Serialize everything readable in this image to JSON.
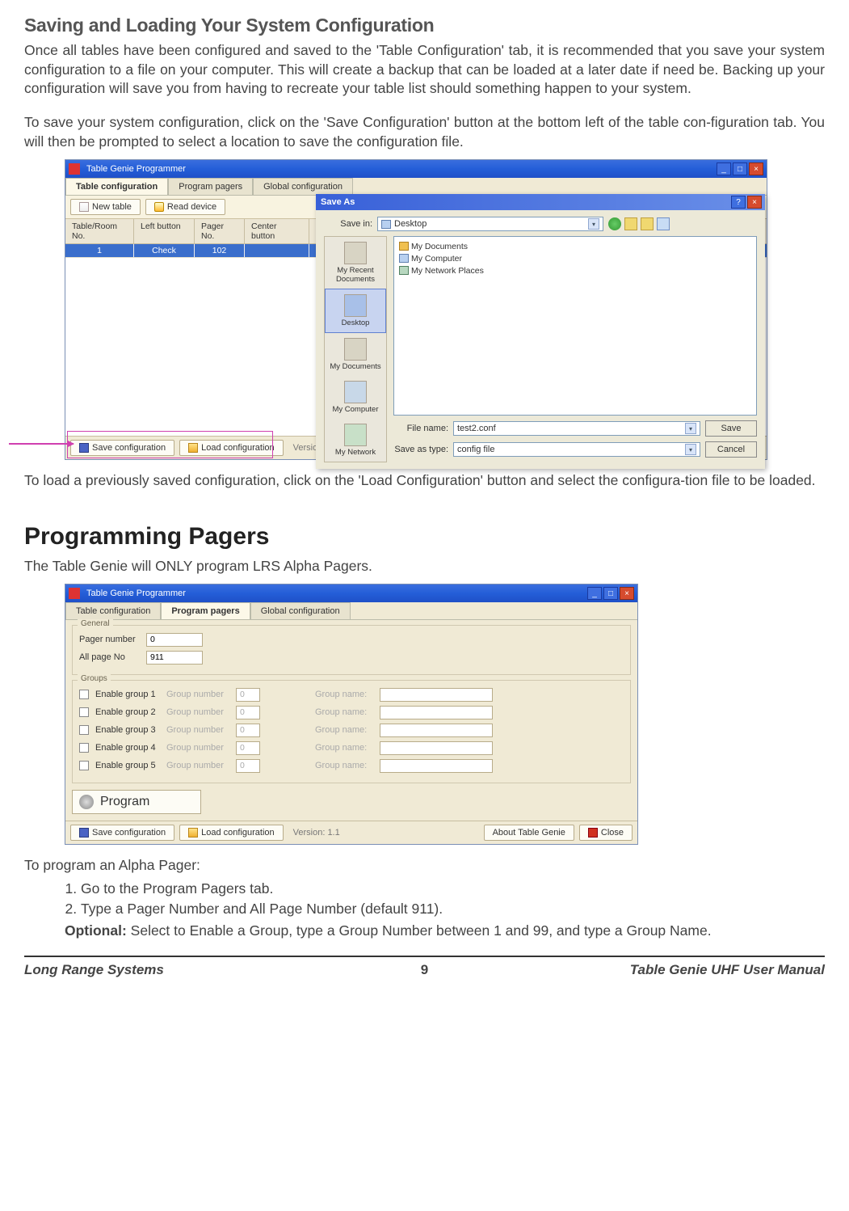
{
  "section1_title": "Saving and Loading Your System Configuration",
  "para1": "Once all tables have been configured and saved to the 'Table Configuration' tab, it is recommended that you save your system configuration to a file on your computer. This will create a backup that can be loaded at a later date if need be. Backing up your configuration will save you from having to recreate your table list should something happen to your system.",
  "para2": "To save your system configuration, click on the 'Save Configuration' button at the bottom left of the table con-figuration tab. You will then be prompted to select a location to save the configuration file.",
  "para3": "To load a previously saved configuration, click on the 'Load Configuration' button and select the configura-tion file to be loaded.",
  "section2_title": "Programming Pagers",
  "para4": "The Table Genie will ONLY program LRS Alpha Pagers.",
  "para5": "To program an Alpha Pager:",
  "step1": "Go to the Program Pagers tab.",
  "step2": "Type a Pager Number and All Page Number (default 911).",
  "optional_lbl": "Optional:",
  "optional_txt": " Select to Enable a Group, type a Group Number between 1 and 99, and type a Group Name.",
  "footer": {
    "left": "Long Range Systems",
    "center": "9",
    "right": "Table Genie UHF User Manual"
  },
  "app": {
    "title": "Table Genie Programmer",
    "tabs": {
      "t1": "Table configuration",
      "t2": "Program pagers",
      "t3": "Global configuration"
    },
    "toolbar": {
      "newtable": "New table",
      "readdevice": "Read device"
    },
    "headers": {
      "h1": "Table/Room No.",
      "h2": "Left button",
      "h3": "Pager No.",
      "h4": "Center button"
    },
    "row1": {
      "c1": "1",
      "c2": "Check",
      "c3": "102"
    },
    "status": {
      "saveconf": "Save configuration",
      "loadconf": "Load configuration",
      "version": "Version: 1.1",
      "about": "About Table Genie",
      "close": "Close"
    }
  },
  "dlg": {
    "title": "Save As",
    "help": "?",
    "savein_lbl": "Save in:",
    "savein_val": "Desktop",
    "places": {
      "p1": "My Recent Documents",
      "p2": "Desktop",
      "p3": "My Documents",
      "p4": "My Computer",
      "p5": "My Network"
    },
    "items": {
      "i1": "My Documents",
      "i2": "My Computer",
      "i3": "My Network Places"
    },
    "filename_lbl": "File name:",
    "filename_val": "test2.conf",
    "saveastype_lbl": "Save as type:",
    "saveastype_val": "config file",
    "save": "Save",
    "cancel": "Cancel"
  },
  "prog": {
    "general": "General",
    "pagernum_lbl": "Pager number",
    "pagernum_val": "0",
    "allpage_lbl": "All page No",
    "allpage_val": "911",
    "groups": "Groups",
    "g1": "Enable group 1",
    "g2": "Enable group 2",
    "g3": "Enable group 3",
    "g4": "Enable group 4",
    "g5": "Enable group 5",
    "grpnum_lbl": "Group number",
    "grpname_lbl": "Group name:",
    "g_val": "0",
    "program": "Program"
  }
}
